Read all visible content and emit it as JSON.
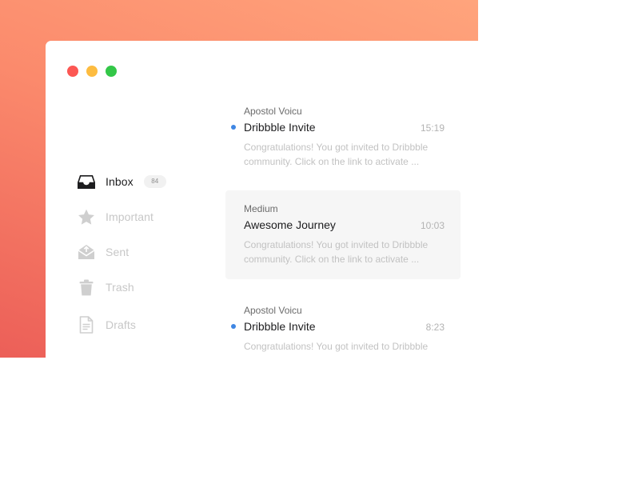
{
  "window": {
    "traffic_lights": [
      "close",
      "minimize",
      "maximize"
    ],
    "accent_colors": {
      "close": "#fc5753",
      "minimize": "#fdbc40",
      "maximize": "#33c748",
      "unread": "#3f86e3"
    }
  },
  "sidebar": {
    "items": [
      {
        "label": "Inbox",
        "icon": "inbox-icon",
        "badge": "84",
        "active": true
      },
      {
        "label": "Important",
        "icon": "star-icon",
        "active": false
      },
      {
        "label": "Sent",
        "icon": "sent-envelope-icon",
        "active": false
      },
      {
        "label": "Trash",
        "icon": "trash-icon",
        "active": false
      },
      {
        "label": "Drafts",
        "icon": "document-icon",
        "active": false
      }
    ]
  },
  "messages": [
    {
      "sender": "Apostol Voicu",
      "subject": "Dribbble Invite",
      "time": "15:19",
      "preview_line1": "Congratulations! You got invited to Dribbble",
      "preview_line2": "community. Click on the link to activate ...",
      "unread": true,
      "selected": false
    },
    {
      "sender": "Medium",
      "subject": "Awesome Journey",
      "time": "10:03",
      "preview_line1": "Congratulations! You got invited to Dribbble",
      "preview_line2": "community. Click on the link to activate ...",
      "unread": false,
      "selected": true
    },
    {
      "sender": "Apostol Voicu",
      "subject": "Dribbble Invite",
      "time": "8:23",
      "preview_line1": "Congratulations! You got invited to Dribbble",
      "unread": true,
      "selected": false
    }
  ]
}
